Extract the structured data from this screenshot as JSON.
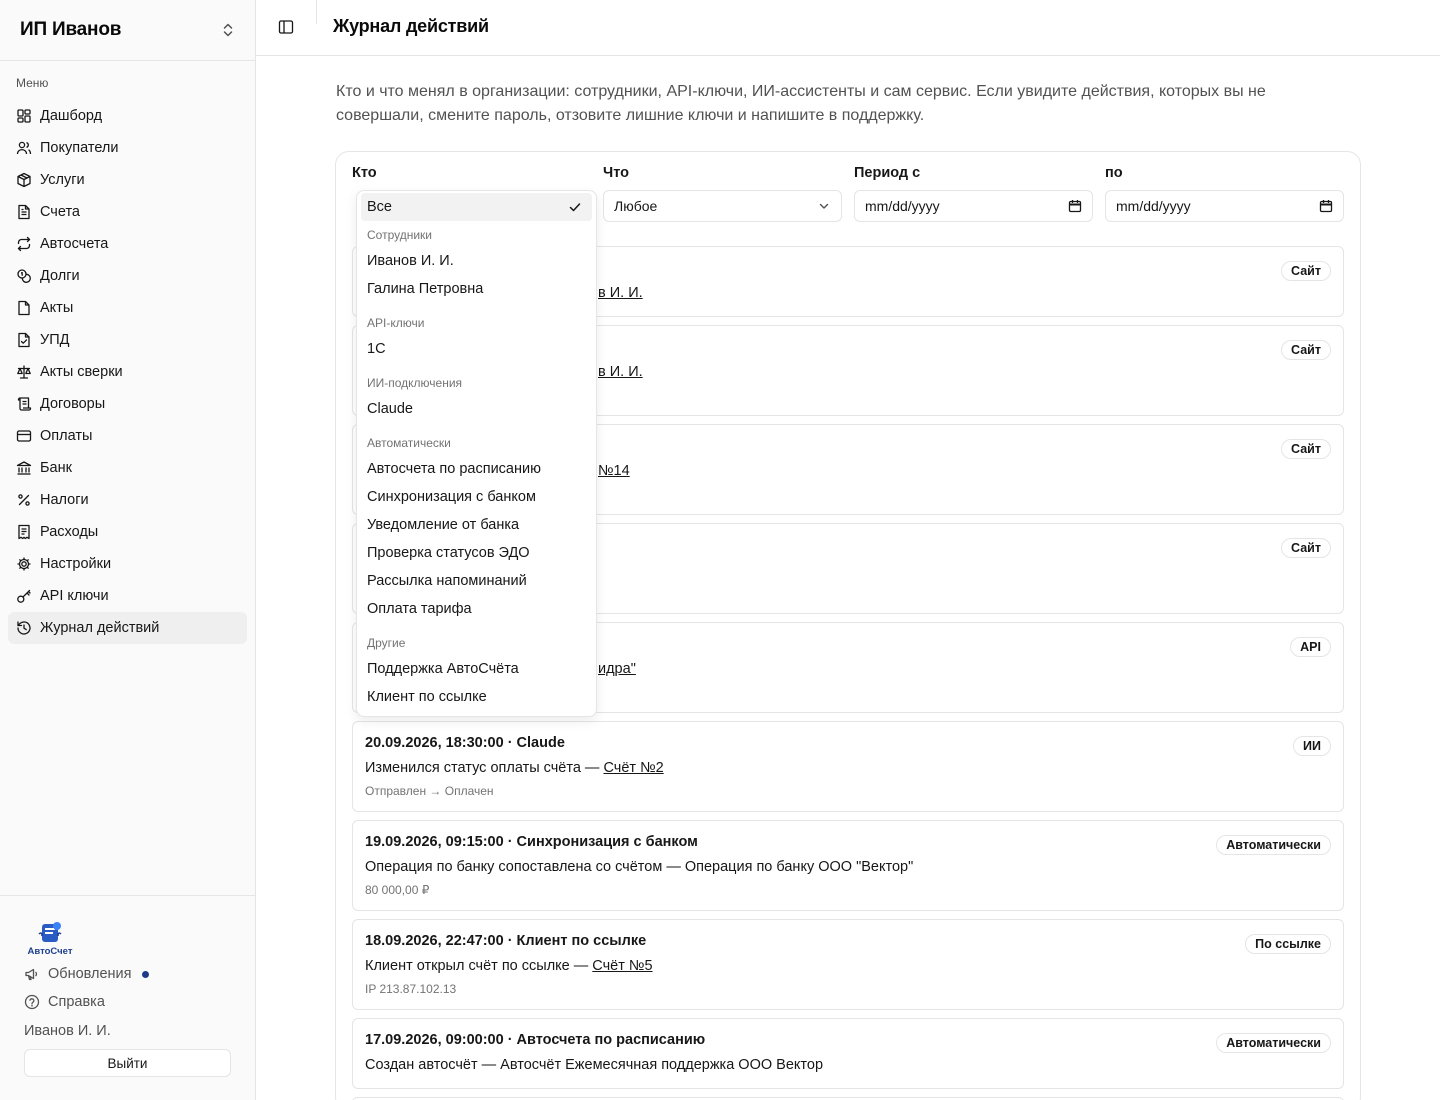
{
  "sidebar": {
    "org_name": "ИП Иванов",
    "menu_label": "Меню",
    "items": [
      {
        "label": "Дашборд",
        "icon": "dashboard-icon"
      },
      {
        "label": "Покупатели",
        "icon": "users-icon"
      },
      {
        "label": "Услуги",
        "icon": "package-icon"
      },
      {
        "label": "Счета",
        "icon": "file-text-icon"
      },
      {
        "label": "Автосчета",
        "icon": "repeat-icon"
      },
      {
        "label": "Долги",
        "icon": "coins-icon"
      },
      {
        "label": "Акты",
        "icon": "file-icon"
      },
      {
        "label": "УПД",
        "icon": "file-check-icon"
      },
      {
        "label": "Акты сверки",
        "icon": "scale-icon"
      },
      {
        "label": "Договоры",
        "icon": "scroll-icon"
      },
      {
        "label": "Оплаты",
        "icon": "credit-card-icon"
      },
      {
        "label": "Банк",
        "icon": "bank-icon"
      },
      {
        "label": "Налоги",
        "icon": "percent-icon"
      },
      {
        "label": "Расходы",
        "icon": "receipt-icon"
      },
      {
        "label": "Настройки",
        "icon": "gear-icon"
      },
      {
        "label": "API ключи",
        "icon": "key-icon"
      },
      {
        "label": "Журнал действий",
        "icon": "history-icon",
        "active": true
      }
    ],
    "footer": {
      "logo_text": "АвтоСчет",
      "updates_label": "Обновления",
      "help_label": "Справка",
      "user_name": "Иванов И. И.",
      "logout_label": "Выйти"
    }
  },
  "header": {
    "title": "Журнал действий"
  },
  "intro": "Кто и что менял в организации: сотрудники, API-ключи, ИИ-ассистенты и сам сервис. Если увидите действия, которых вы не совершали, смените пароль, отзовите лишние ключи и напишите в поддержку.",
  "filters": {
    "who_label": "Кто",
    "who_value": "Все",
    "what_label": "Что",
    "what_value": "Любое",
    "from_label": "Период с",
    "from_placeholder": "mm/dd/yyyy",
    "to_label": "по",
    "to_placeholder": "mm/dd/yyyy"
  },
  "dropdown": {
    "selected": "Все",
    "groups": [
      {
        "label": "Сотрудники",
        "items": [
          "Иванов И. И.",
          "Галина Петровна"
        ]
      },
      {
        "label": "API-ключи",
        "items": [
          "1С"
        ]
      },
      {
        "label": "ИИ-подключения",
        "items": [
          "Claude"
        ]
      },
      {
        "label": "Автоматически",
        "items": [
          "Автосчета по расписанию",
          "Синхронизация с банком",
          "Уведомление от банка",
          "Проверка статусов ЭДО",
          "Рассылка напоминаний",
          "Оплата тарифа"
        ]
      },
      {
        "label": "Другие",
        "items": [
          "Поддержка АвтоСчёта",
          "Клиент по ссылке"
        ]
      }
    ]
  },
  "log_rows": [
    {
      "head": "",
      "text_tail": "в И. И.",
      "badge": "Сайт"
    },
    {
      "head": "",
      "text_tail": "в И. И.",
      "badge": "Сайт"
    },
    {
      "head": "",
      "text_tail": "№14",
      "badge": "Сайт"
    },
    {
      "head": "",
      "text_tail": "",
      "badge": "Сайт"
    },
    {
      "head": "",
      "text_tail": "идра\"",
      "badge": "API"
    },
    {
      "head": "20.09.2026, 18:30:00 · Claude",
      "text": "Изменился статус оплаты счёта — ",
      "link": "Счёт №2",
      "meta": "Отправлен → Оплачен",
      "badge": "ИИ"
    },
    {
      "head": "19.09.2026, 09:15:00 · Синхронизация с банком",
      "text": "Операция по банку сопоставлена со счётом — Операция по банку ООО \"Вектор\"",
      "link": "",
      "meta": "80 000,00 ₽",
      "badge": "Автоматически"
    },
    {
      "head": "18.09.2026, 22:47:00 · Клиент по ссылке",
      "text": "Клиент открыл счёт по ссылке — ",
      "link": "Счёт №5",
      "meta": "IP 213.87.102.13",
      "badge": "По ссылке"
    },
    {
      "head": "17.09.2026, 09:00:00 · Автосчета по расписанию",
      "text": "Создан автосчёт — Автосчёт Ежемесячная поддержка ООО Вектор",
      "link": "",
      "meta": "",
      "badge": "Автоматически"
    }
  ]
}
